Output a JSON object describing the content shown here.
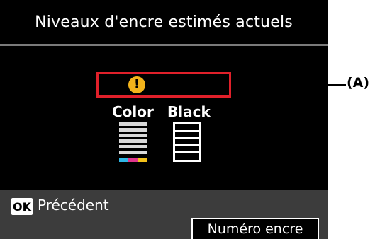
{
  "screen": {
    "title": "Niveaux d'encre estimés actuels"
  },
  "ink": {
    "color_label": "Color",
    "black_label": "Black"
  },
  "footer": {
    "ok_label": "OK",
    "back_label": "Précédent",
    "soft_key_label": "Numéro encre"
  },
  "callout": {
    "label": "(A)"
  },
  "colors": {
    "warning_box": "#e0202a",
    "warning_icon": "#f2b31b",
    "cyan": "#2fb7e6",
    "magenta": "#e0368c",
    "yellow": "#f4c21a"
  }
}
